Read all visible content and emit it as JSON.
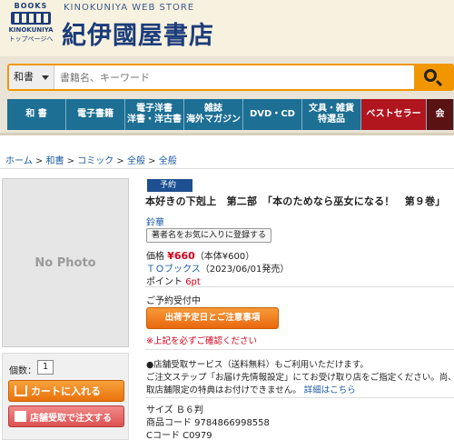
{
  "header": {
    "logo_books": "BOOKS",
    "logo_name": "KINOKUNIYA",
    "logo_top": "トップページへ",
    "store_label": "KINOKUNIYA WEB STORE",
    "brand": "紀伊國屋書店"
  },
  "search": {
    "category": "和書",
    "placeholder": "書籍名、キーワード"
  },
  "nav": {
    "items": [
      "和 書",
      "電子書籍",
      "電子洋書\n洋書・洋古書",
      "雑誌\n海外マガジン",
      "DVD・CD",
      "文具・雑貨\n特選品",
      "ベストセラー",
      "会"
    ]
  },
  "breadcrumb": [
    "ホーム",
    "和書",
    "コミック",
    "全般",
    "全般"
  ],
  "product": {
    "image_placeholder": "No Photo",
    "badge": "予約",
    "title": "本好きの下剋上　第二部　「本のためなら巫女になる！　第９巻」",
    "author": "鈴華",
    "fav_button": "著者名をお気に入りに登録する",
    "price_label": "価格",
    "price": "¥660",
    "price_note": "（本体¥600）",
    "publisher": "ＴＯブックス",
    "release": "（2023/06/01発売）",
    "points_label": "ポイント",
    "points": "6pt",
    "reserve_status": "ご予約受付中",
    "shipping_button": "出荷予定日とご注意事項",
    "warning": "※上記を必ずご確認ください",
    "service_line1": "●店舗受取サービス（送料無料）もご利用いただけます。",
    "service_line2": "ご注文ステップ「お届け先情報設定」にてお受け取り店をご指定ください。尚、",
    "service_line3": "取店舗限定の特典はお付けできません。",
    "service_link": "詳細はこちら",
    "size": "サイズ Ｂ６判",
    "product_code": "商品コード 9784866998558",
    "c_code": "Cコード C0979"
  },
  "cart": {
    "qty_label": "個数：",
    "qty_value": "1",
    "cart_button": "カートに入れる",
    "store_button": "店舗受取で注文する"
  },
  "colors": {
    "nav_blue": "#1d6f93",
    "bestseller_red": "#b1151e",
    "accent_orange": "#f29600",
    "price_red": "#d0021b",
    "link_blue": "#1a5aa6"
  }
}
